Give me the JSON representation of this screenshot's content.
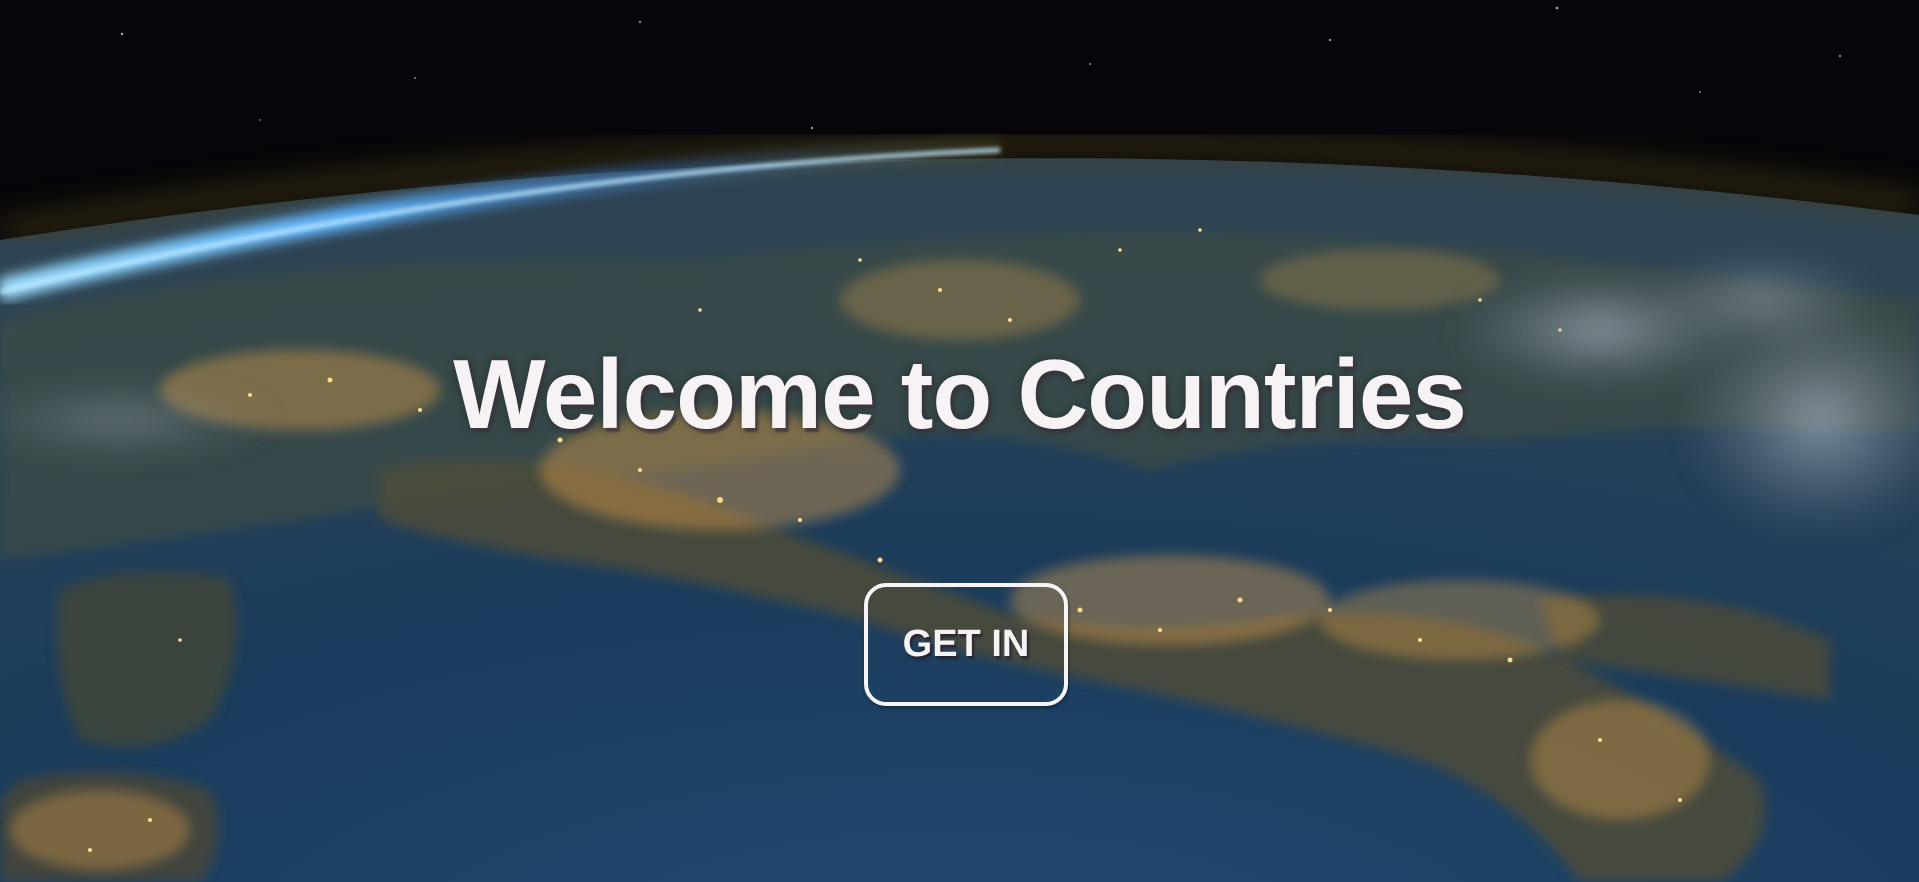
{
  "hero": {
    "title": "Welcome to Countries",
    "button_label": "GET IN",
    "background_image": "earth-at-night-from-space"
  },
  "colors": {
    "text": "#f7f2f4",
    "button_border": "#f7f4f6",
    "space": "#060509",
    "atmosphere": "#5fb4ff",
    "ocean": "#1d3d5e",
    "city_lights": "#ffc46a"
  }
}
